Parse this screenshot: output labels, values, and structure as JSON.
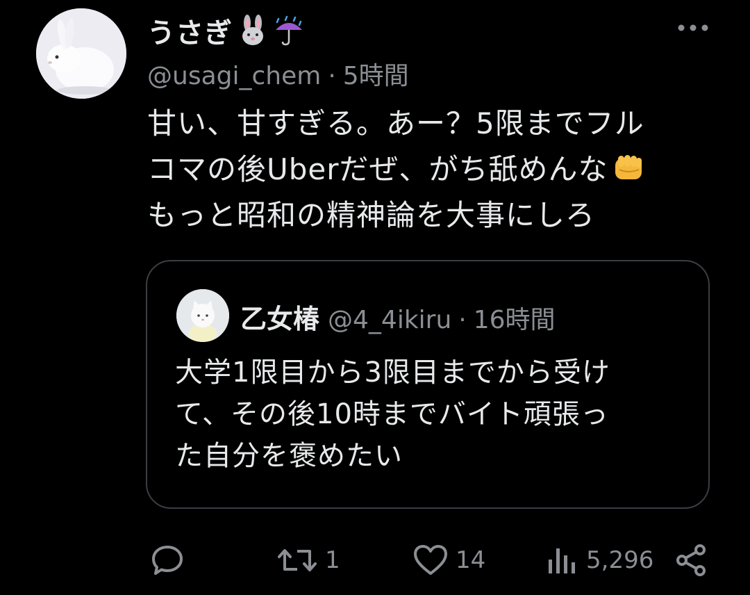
{
  "author": {
    "display_name": "うさぎ",
    "name_emojis": [
      "rabbit-face-emoji",
      "umbrella-rain-emoji"
    ],
    "handle": "@usagi_chem",
    "separator": "·",
    "time": "5時間"
  },
  "post": {
    "lines": [
      "甘い、甘すぎる。あー？5限までフル",
      "コマの後Uberだぜ、がち舐めんな",
      "もっと昭和の精神論を大事にしろ"
    ],
    "inline_emoji": "oncoming-fist-emoji"
  },
  "quote": {
    "display_name": "乙女椿",
    "handle": "@4_4ikiru",
    "separator": "·",
    "time": "16時間",
    "lines": [
      "大学1限目から3限目までから受け",
      "て、その後10時までバイト頑張っ",
      "た自分を褒めたい"
    ]
  },
  "actions": {
    "reply": {
      "icon": "reply-icon",
      "count": ""
    },
    "retweet": {
      "icon": "retweet-icon",
      "count": "1"
    },
    "like": {
      "icon": "heart-icon",
      "count": "14"
    },
    "views": {
      "icon": "views-icon",
      "count": "5,296"
    },
    "share": {
      "icon": "share-icon"
    }
  },
  "colors": {
    "background": "#000000",
    "text": "#e7e9ea",
    "secondary": "#8b8f94",
    "border": "#3a3e43"
  }
}
